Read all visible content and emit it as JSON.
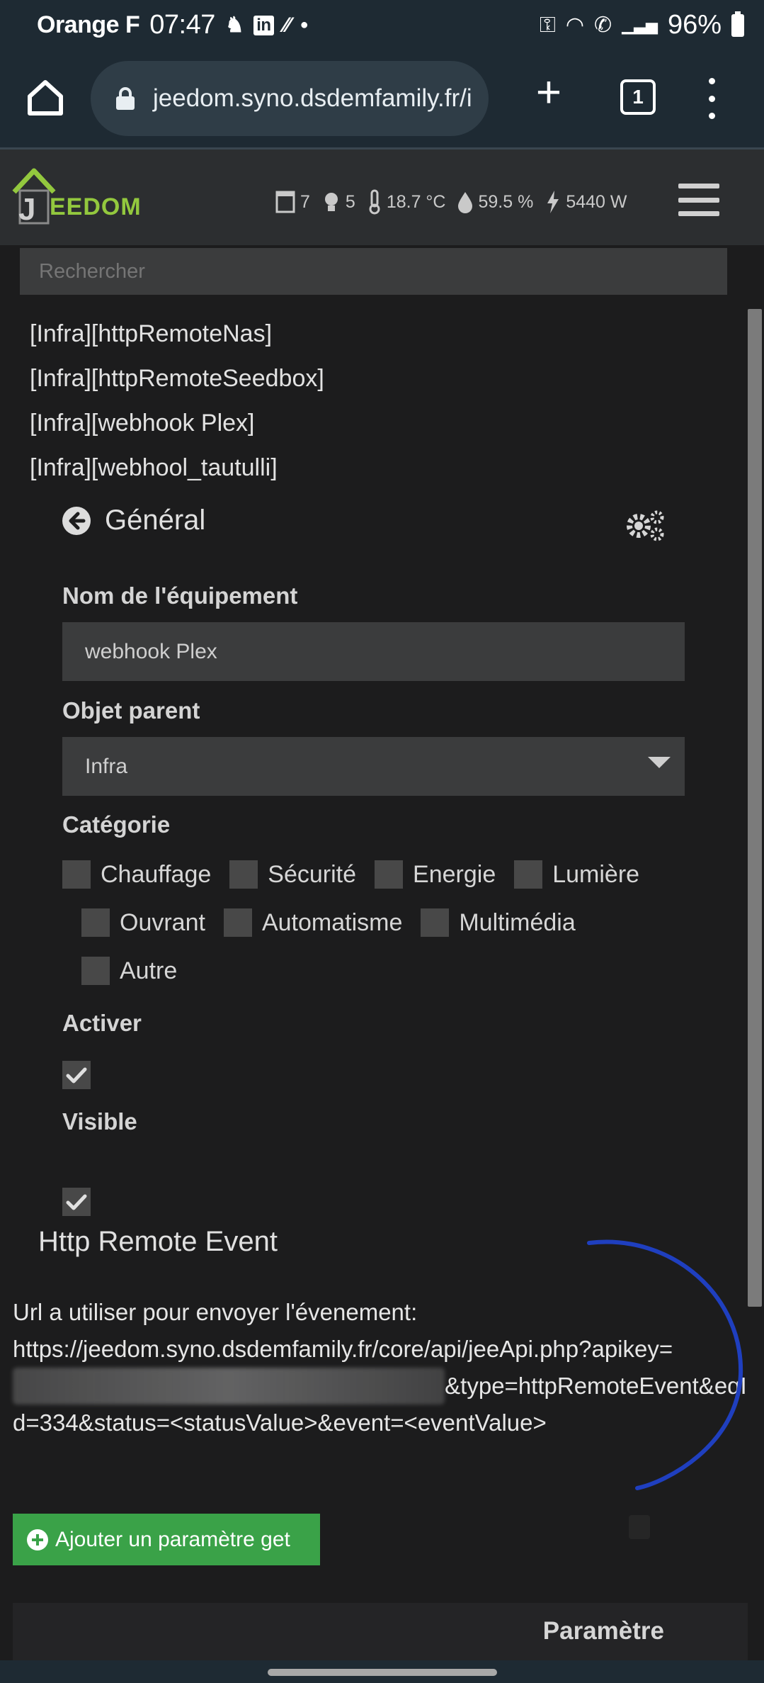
{
  "status_bar": {
    "carrier": "Orange F",
    "time": "07:47",
    "battery": "96%"
  },
  "browser": {
    "url": "jeedom.syno.dsdemfamily.fr/i",
    "tab_count": "1"
  },
  "app": {
    "logo_j": "J",
    "logo_rest": "EEDOM",
    "summary": {
      "openings": "7",
      "lights": "5",
      "temperature": "18.7 °C",
      "humidity": "59.5 %",
      "power": "5440 W"
    }
  },
  "search": {
    "placeholder": "Rechercher"
  },
  "equipment_list": [
    "[Infra][httpRemoteNas]",
    "[Infra][httpRemoteSeedbox]",
    "[Infra][webhook Plex]",
    "[Infra][webhool_tautulli]"
  ],
  "tab": {
    "title": "Général"
  },
  "form": {
    "name_label": "Nom de l'équipement",
    "name_value": "webhook Plex",
    "parent_label": "Objet parent",
    "parent_value": "Infra",
    "category_label": "Catégorie",
    "categories": [
      "Chauffage",
      "Sécurité",
      "Energie",
      "Lumière",
      "Ouvrant",
      "Automatisme",
      "Multimédia",
      "Autre"
    ],
    "enable_label": "Activer",
    "visible_label": "Visible"
  },
  "http_remote": {
    "title": "Http Remote Event",
    "url_intro": "Url a utiliser pour envoyer l'évenement:",
    "url_part1": "https://jeedom.syno.dsdemfamily.fr/core/api/jeeApi.php?apikey=",
    "url_part2": "&type=httpRemoteEvent&eqId=334&status=<statusValue>&event=<eventValue>"
  },
  "add_param_button": "Ajouter un paramètre get",
  "table": {
    "col_parameter": "Paramètre"
  }
}
